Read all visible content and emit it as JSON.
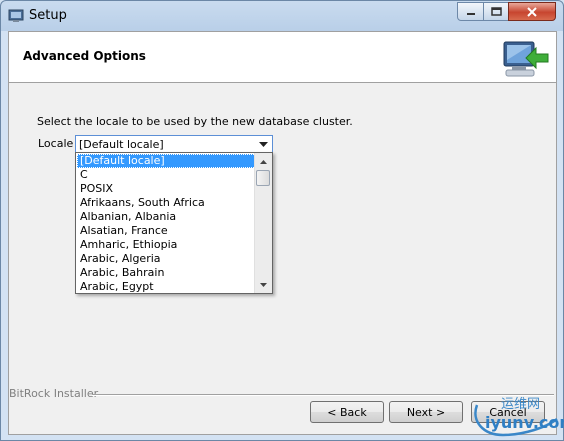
{
  "window": {
    "title": "Setup",
    "accent": "#3399ff"
  },
  "header": {
    "title": "Advanced Options",
    "icon": "install-monitor-icon"
  },
  "main": {
    "prompt": "Select the locale to be used by the new database cluster.",
    "locale_label": "Locale",
    "locale_value": "[Default locale]",
    "options": [
      "[Default locale]",
      "C",
      "POSIX",
      "Afrikaans, South Africa",
      "Albanian, Albania",
      "Alsatian, France",
      "Amharic, Ethiopia",
      "Arabic, Algeria",
      "Arabic, Bahrain",
      "Arabic, Egypt"
    ],
    "selected_index": 0
  },
  "footer": {
    "installer_label": "BitRock Installer",
    "back_label": "< Back",
    "next_label": "Next >",
    "cancel_label": "Cancel"
  },
  "watermark": {
    "line1": "运维网",
    "line2": "iyunv.com"
  }
}
